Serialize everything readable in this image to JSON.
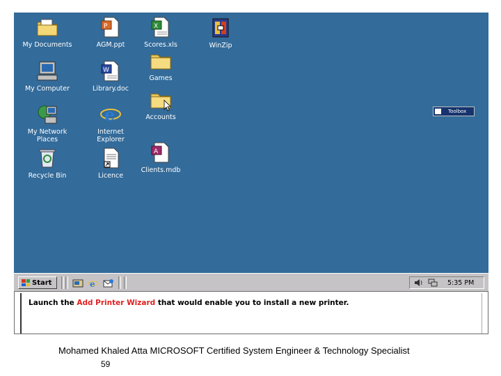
{
  "desktop": {
    "icons": {
      "my_documents": "My Documents",
      "agm_ppt": "AGM.ppt",
      "scores_xls": "Scores.xls",
      "winzip": "WinZip",
      "my_computer": "My Computer",
      "library_doc": "Library.doc",
      "games": "Games",
      "accounts": "Accounts",
      "my_network_places": "My Network\nPlaces",
      "internet_explorer": "Internet\nExplorer",
      "clients_mdb": "Clients.mdb",
      "recycle_bin": "Recycle Bin",
      "licence": "Licence"
    },
    "toolbox_label": "Toolbox",
    "background_color": "#336b9a"
  },
  "taskbar": {
    "start_label": "Start",
    "clock": "5:35 PM"
  },
  "caption": {
    "part1": "Launch the ",
    "part2": "Add Printer Wizard",
    "part3": " that would enable you to install a new printer.",
    "highlight_color": "#e02020"
  },
  "footer": {
    "text": "Mohamed Khaled Atta MICROSOFT Certified System Engineer & Technology Specialist",
    "page_number": "59"
  }
}
